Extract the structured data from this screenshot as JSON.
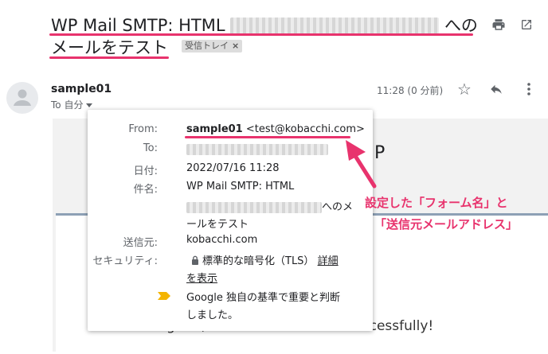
{
  "subject": {
    "prefix": "WP Mail SMTP: HTML",
    "suffix": "への",
    "line2": "メールをテスト",
    "label_chip": "受信トレイ",
    "chip_close": "×"
  },
  "header_icons": [
    "print-icon",
    "open-in-new-window-icon"
  ],
  "message": {
    "sender": "sample01",
    "to": "To 自分",
    "time": "11:28 (0 分前)",
    "star": "☆",
    "big_letter": "P",
    "body_text": "Congrats, test email was sent successfully!"
  },
  "details": {
    "from_label": "From:",
    "from_name": "sample01",
    "from_email": "<test@kobacchi.com>",
    "to_label": "To:",
    "date_label": "日付:",
    "date_value": "2022/07/16 11:28",
    "subject_label": "件名:",
    "subject_line1": "WP Mail SMTP: HTML",
    "subject_line2_suffix": "へのメ",
    "subject_line3": "ールをテスト",
    "mailed_by_label": "送信元:",
    "mailed_by_value": "kobacchi.com",
    "security_label": "セキュリティ:",
    "security_value": "標準的な暗号化（TLS）",
    "security_link_1": "詳細",
    "security_link_2": "を表示",
    "importance_line1": "Google 独自の基準で重要と判断",
    "importance_line2": "しました。"
  },
  "annotation": {
    "line1": "設定した「フォーム名」と",
    "line2": "「送信元メールアドレス」",
    "color": "#e8336d"
  }
}
